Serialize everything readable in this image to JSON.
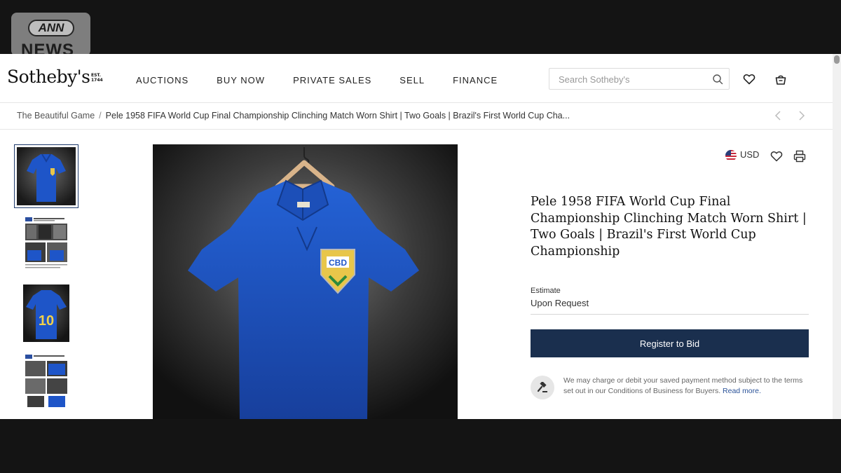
{
  "overlay": {
    "ann_top": "ANN",
    "ann_bottom": "NEWS"
  },
  "header": {
    "logo": "Sotheby's",
    "logo_est": "EST. 1744",
    "nav": [
      "AUCTIONS",
      "BUY NOW",
      "PRIVATE SALES",
      "SELL",
      "FINANCE"
    ],
    "search_placeholder": "Search Sotheby's",
    "icons": [
      "search-icon",
      "heart-icon",
      "shopping-bag-icon"
    ]
  },
  "breadcrumb": {
    "parent": "The Beautiful Game",
    "separator": "/",
    "current": "Pele 1958 FIFA World Cup Final Championship Clinching Match Worn Shirt | Two Goals | Brazil's First World Cup Cha..."
  },
  "gallery": {
    "thumbnails": [
      "shirt-front",
      "article-collage",
      "shirt-back-10",
      "article-collage-2"
    ],
    "selected_index": 0,
    "main_image": "blue shirt on hanger",
    "badge_text": "CBD",
    "back_number": "10"
  },
  "lot": {
    "currency": "USD",
    "title": "Pele 1958 FIFA World Cup Final Championship Clinching Match Worn Shirt | Two Goals | Brazil's First World Cup Championship",
    "estimate_label": "Estimate",
    "estimate_value": "Upon Request",
    "bid_button": "Register to Bid",
    "note_text": "We may charge or debit your saved payment method subject to the terms set out in our Conditions of Business for Buyers.",
    "note_link": "Read more."
  },
  "colors": {
    "accent": "#1a2f4e",
    "shirt_blue": "#1e55c8",
    "badge_yellow": "#e8c64a"
  }
}
